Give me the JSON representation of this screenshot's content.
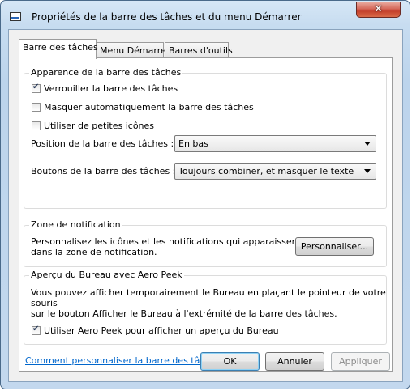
{
  "window": {
    "title": "Propriétés de la barre des tâches et du menu Démarrer"
  },
  "tabs": [
    {
      "label": "Barre des tâches",
      "active": true
    },
    {
      "label": "Menu Démarrer",
      "active": false
    },
    {
      "label": "Barres d'outils",
      "active": false
    }
  ],
  "appearance": {
    "legend": "Apparence de la barre des tâches",
    "lock_label": "Verrouiller la barre des tâches",
    "lock_checked": true,
    "autohide_label": "Masquer automatiquement la barre des tâches",
    "autohide_checked": false,
    "small_icons_label": "Utiliser de petites icônes",
    "small_icons_checked": false,
    "position_label": "Position de la barre des tâches :",
    "position_value": "En bas",
    "buttons_label": "Boutons de la barre des tâches :",
    "buttons_value": "Toujours combiner, et masquer le texte"
  },
  "notification": {
    "legend": "Zone de notification",
    "line1": "Personnalisez les icônes et les notifications qui apparaissent",
    "line2": "dans la zone de notification.",
    "customize_label": "Personnaliser..."
  },
  "peek": {
    "legend": "Aperçu du Bureau avec Aero Peek",
    "line1": "Vous pouvez afficher temporairement le Bureau en plaçant le pointeur de votre souris",
    "line2": "sur le bouton Afficher le Bureau à l'extrémité de la barre des tâches.",
    "checkbox_label": "Utiliser Aero Peek pour afficher un aperçu du Bureau",
    "checkbox_checked": true
  },
  "help_link": "Comment personnaliser la barre des tâches ?",
  "buttons": {
    "ok": "OK",
    "cancel": "Annuler",
    "apply": "Appliquer"
  },
  "icons": {
    "app": "taskbar-properties-icon",
    "close": "close-icon",
    "dropdown": "chevron-down-icon"
  }
}
